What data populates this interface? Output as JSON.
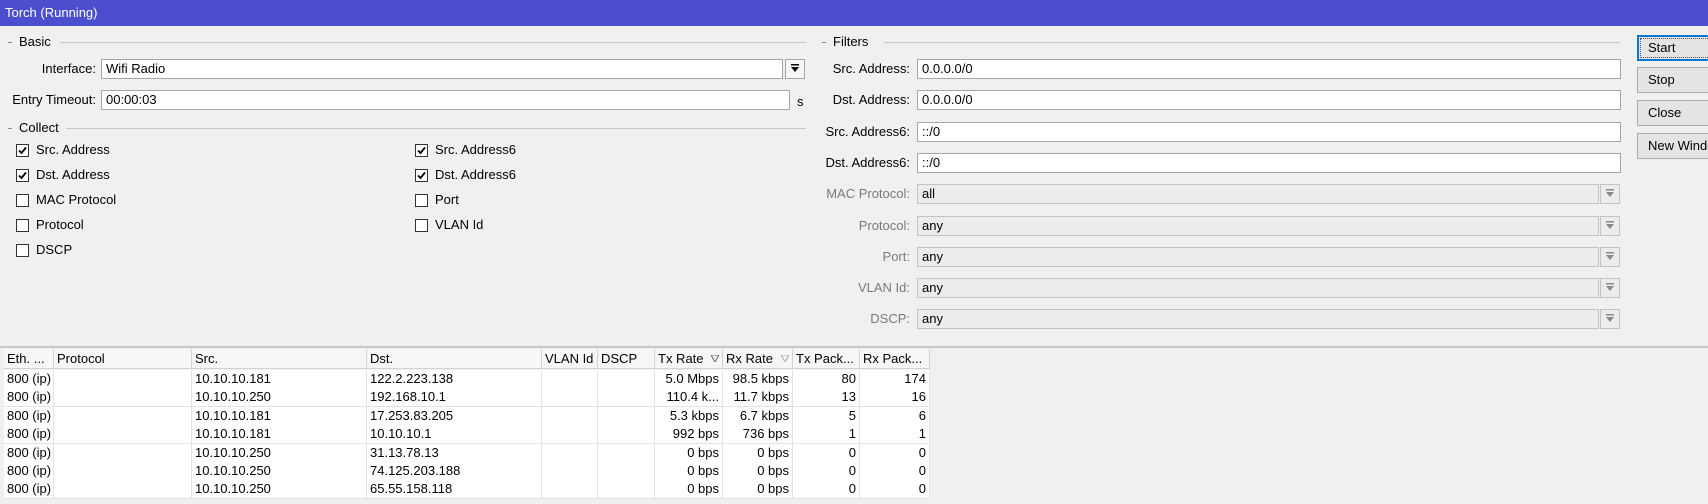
{
  "window": {
    "title": "Torch (Running)"
  },
  "basic": {
    "title": "Basic",
    "interface_label": "Interface:",
    "interface_value": "Wifi Radio",
    "entry_timeout_label": "Entry Timeout:",
    "entry_timeout_value": "00:00:03",
    "entry_timeout_unit": "s"
  },
  "collect": {
    "title": "Collect",
    "items": [
      {
        "label": "Src. Address",
        "checked": true
      },
      {
        "label": "Dst. Address",
        "checked": true
      },
      {
        "label": "MAC Protocol",
        "checked": false
      },
      {
        "label": "Protocol",
        "checked": false
      },
      {
        "label": "DSCP",
        "checked": false
      },
      {
        "label": "Src. Address6",
        "checked": true
      },
      {
        "label": "Dst. Address6",
        "checked": true
      },
      {
        "label": "Port",
        "checked": false
      },
      {
        "label": "VLAN Id",
        "checked": false
      }
    ]
  },
  "filters": {
    "title": "Filters",
    "fields": [
      {
        "label": "Src. Address:",
        "value": "0.0.0.0/0"
      },
      {
        "label": "Dst. Address:",
        "value": "0.0.0.0/0"
      },
      {
        "label": "Src. Address6:",
        "value": "::/0"
      },
      {
        "label": "Dst. Address6:",
        "value": "::/0"
      },
      {
        "label": "MAC Protocol:",
        "value": "all"
      },
      {
        "label": "Protocol:",
        "value": "any"
      },
      {
        "label": "Port:",
        "value": "any"
      },
      {
        "label": "VLAN Id:",
        "value": "any"
      },
      {
        "label": "DSCP:",
        "value": "any"
      }
    ]
  },
  "buttons": {
    "start": "Start",
    "stop": "Stop",
    "close": "Close",
    "new_window": "New Window"
  },
  "table": {
    "columns": [
      "Eth. ...",
      "Protocol",
      "Src.",
      "Dst.",
      "VLAN Id",
      "DSCP",
      "Tx Rate",
      "Rx Rate",
      "Tx Pack...",
      "Rx Pack..."
    ],
    "rows": [
      [
        "800 (ip)",
        "",
        "10.10.10.181",
        "122.2.223.138",
        "",
        "",
        "5.0 Mbps",
        "98.5 kbps",
        "80",
        "174"
      ],
      [
        "800 (ip)",
        "",
        "10.10.10.250",
        "192.168.10.1",
        "",
        "",
        "110.4 k...",
        "11.7 kbps",
        "13",
        "16"
      ],
      [
        "800 (ip)",
        "",
        "10.10.10.181",
        "17.253.83.205",
        "",
        "",
        "5.3 kbps",
        "6.7 kbps",
        "5",
        "6"
      ],
      [
        "800 (ip)",
        "",
        "10.10.10.181",
        "10.10.10.1",
        "",
        "",
        "992 bps",
        "736 bps",
        "1",
        "1"
      ],
      [
        "800 (ip)",
        "",
        "10.10.10.250",
        "31.13.78.13",
        "",
        "",
        "0 bps",
        "0 bps",
        "0",
        "0"
      ],
      [
        "800 (ip)",
        "",
        "10.10.10.250",
        "74.125.203.188",
        "",
        "",
        "0 bps",
        "0 bps",
        "0",
        "0"
      ],
      [
        "800 (ip)",
        "",
        "10.10.10.250",
        "65.55.158.118",
        "",
        "",
        "0 bps",
        "0 bps",
        "0",
        "0"
      ]
    ]
  }
}
